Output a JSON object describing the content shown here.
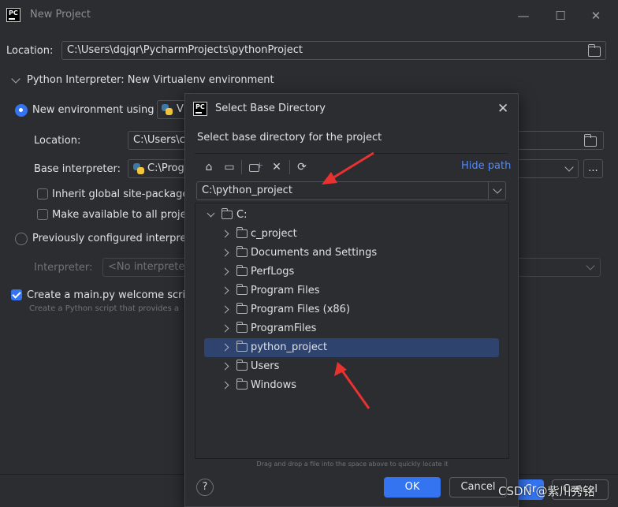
{
  "window": {
    "title": "New Project",
    "location_label": "Location:",
    "location_value": "C:\\Users\\dqjqr\\PycharmProjects\\pythonProject"
  },
  "interpreter": {
    "section_title": "Python Interpreter: New Virtualenv environment",
    "new_env_label": "New environment using",
    "new_env_tool": "V",
    "location_label": "Location:",
    "location_value": "C:\\Users\\c",
    "base_label": "Base interpreter:",
    "base_value": "C:\\Prog",
    "inherit_label": "Inherit global site-package",
    "available_label": "Make available to all projec",
    "previous_label": "Previously configured interpre",
    "interp_label": "Interpreter:",
    "interp_value": "<No interpreter"
  },
  "welcome": {
    "checkbox_label": "Create a main.py welcome scrip",
    "hint": "Create a Python script that provides a"
  },
  "bg_buttons": {
    "create": "Cr",
    "cancel": "Cancel"
  },
  "dialog": {
    "title": "Select Base Directory",
    "description": "Select base directory for the project",
    "hide_path": "Hide path",
    "path_value": "C:\\python_project",
    "root": "C:",
    "items": [
      {
        "label": "c_project"
      },
      {
        "label": "Documents and Settings"
      },
      {
        "label": "PerfLogs"
      },
      {
        "label": "Program Files"
      },
      {
        "label": "Program Files (x86)"
      },
      {
        "label": "ProgramFiles"
      },
      {
        "label": "python_project"
      },
      {
        "label": "Users"
      },
      {
        "label": "Windows"
      }
    ],
    "drag_hint": "Drag and drop a file into the space above to quickly locate it",
    "help": "?",
    "ok": "OK",
    "cancel": "Cancel"
  },
  "watermark": "CSDN @紫川秀铭",
  "annotation_color": "#e8322f"
}
